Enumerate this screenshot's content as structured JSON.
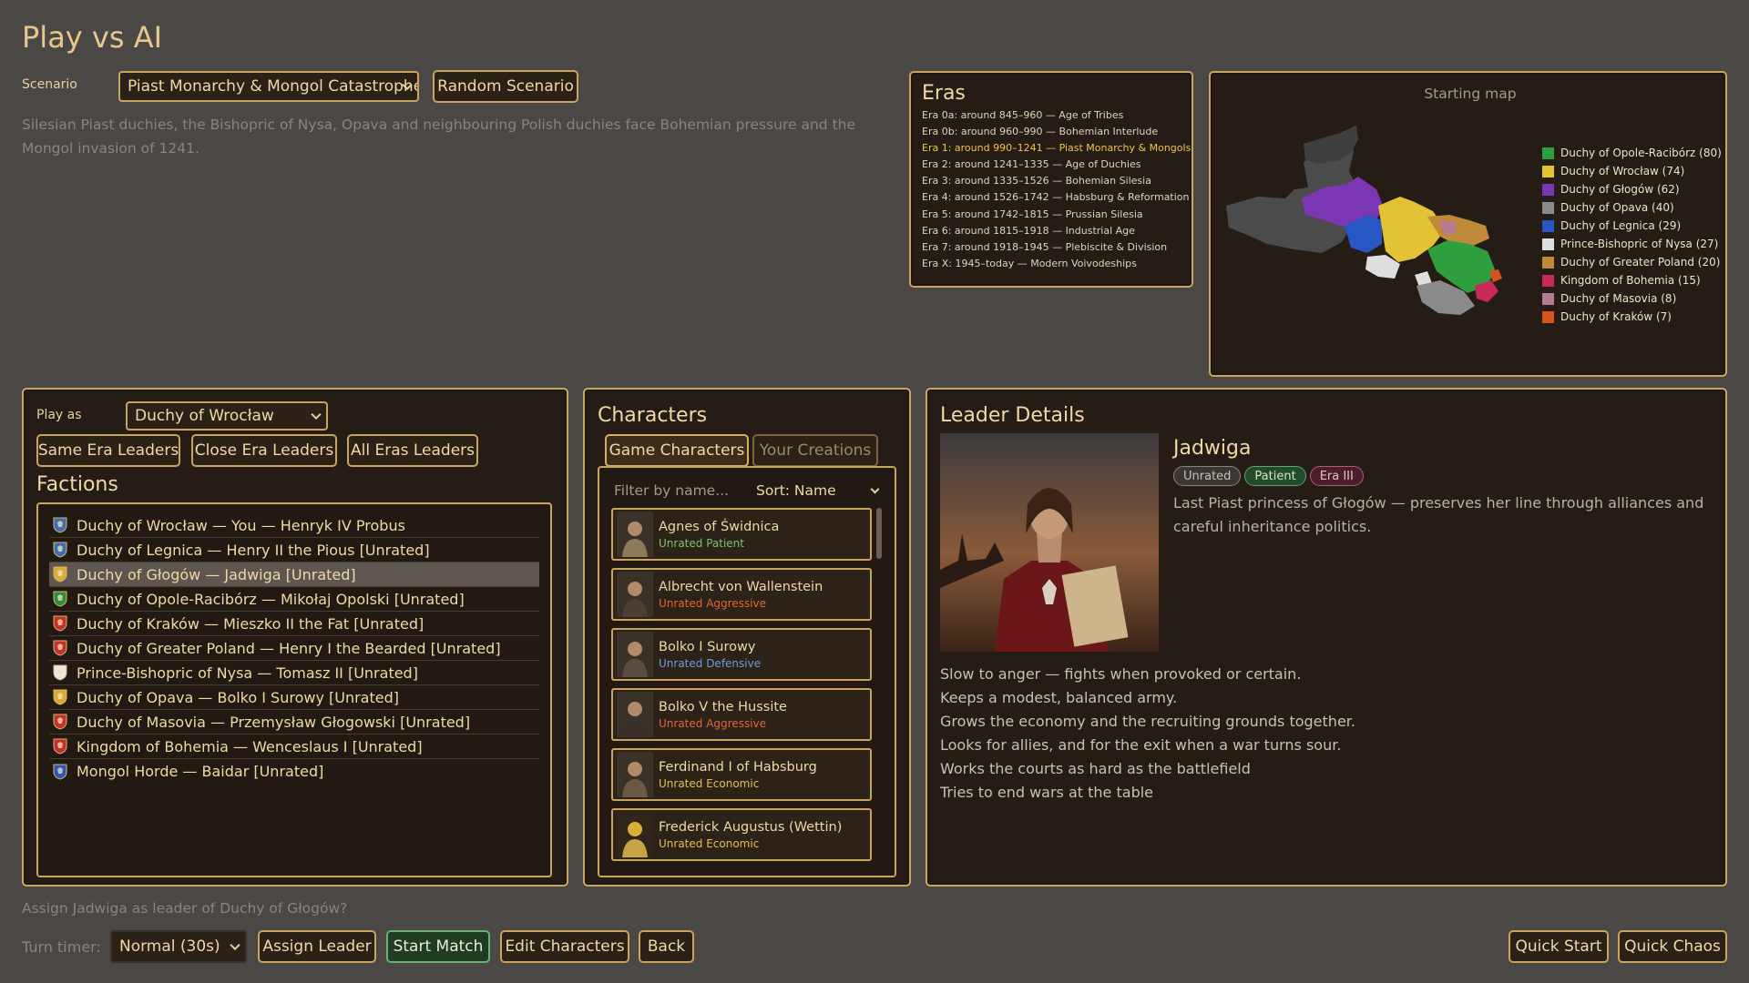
{
  "page": {
    "title": "Play vs AI"
  },
  "scenario": {
    "label": "Scenario",
    "selected": "Piast Monarchy & Mongol Catastrophe",
    "random_label": "Random Scenario",
    "description_line1": "Silesian Piast duchies, the Bishopric of Nysa, Opava and neighbouring Polish duchies face Bohemian pressure and the",
    "description_line2": "Mongol invasion of 1241."
  },
  "eras": {
    "title": "Eras",
    "items": [
      "Era 0a: around 845–960 — Age of Tribes",
      "Era 0b: around 960–990 — Bohemian Interlude",
      "Era 1: around 990–1241 — Piast Monarchy & Mongols",
      "Era 2: around 1241–1335 — Age of Duchies",
      "Era 3: around 1335–1526 — Bohemian Silesia",
      "Era 4: around 1526–1742 — Habsburg & Reformation",
      "Era 5: around 1742–1815 — Prussian Silesia",
      "Era 6: around 1815–1918 — Industrial Age",
      "Era 7: around 1918–1945 — Plebiscite & Division",
      "Era X: 1945–today — Modern Voivodeships"
    ],
    "active_index": 2
  },
  "map": {
    "title": "Starting map",
    "legend": [
      {
        "label": "Duchy of Opole-Racibórz (80)",
        "color": "#2e9e3e"
      },
      {
        "label": "Duchy of Wrocław (74)",
        "color": "#e3c234"
      },
      {
        "label": "Duchy of Głogów (62)",
        "color": "#7b36b3"
      },
      {
        "label": "Duchy of Opava (40)",
        "color": "#8a8a8a"
      },
      {
        "label": "Duchy of Legnica (29)",
        "color": "#2856c4"
      },
      {
        "label": "Prince-Bishopric of Nysa (27)",
        "color": "#dedede"
      },
      {
        "label": "Duchy of Greater Poland (20)",
        "color": "#c08a3a"
      },
      {
        "label": "Kingdom of Bohemia (15)",
        "color": "#c9285a"
      },
      {
        "label": "Duchy of Masovia (8)",
        "color": "#b57b92"
      },
      {
        "label": "Duchy of Kraków (7)",
        "color": "#d8541c"
      }
    ]
  },
  "factions_panel": {
    "play_as_label": "Play as",
    "play_as_value": "Duchy of Wrocław",
    "same_era_label": "Same Era Leaders",
    "close_era_label": "Close Era Leaders",
    "all_eras_label": "All Eras Leaders",
    "title": "Factions",
    "items": [
      {
        "text": "Duchy of Wrocław — You — Henryk IV Probus",
        "shield": "#3d6fb0"
      },
      {
        "text": "Duchy of Legnica — Henry II the Pious [Unrated]",
        "shield": "#3d6fb0"
      },
      {
        "text": "Duchy of Głogów — Jadwiga [Unrated]",
        "shield": "#d9a93a"
      },
      {
        "text": "Duchy of Opole-Racibórz — Mikołaj Opolski [Unrated]",
        "shield": "#2e8e3e"
      },
      {
        "text": "Duchy of Kraków — Mieszko II the Fat [Unrated]",
        "shield": "#c23030"
      },
      {
        "text": "Duchy of Greater Poland — Henry I the Bearded [Unrated]",
        "shield": "#c23030"
      },
      {
        "text": "Prince-Bishopric of Nysa — Tomasz II [Unrated]",
        "shield": "#e8e8e8"
      },
      {
        "text": "Duchy of Opava — Bolko I Surowy [Unrated]",
        "shield": "#d9a93a"
      },
      {
        "text": "Duchy of Masovia — Przemysław Głogowski [Unrated]",
        "shield": "#c23030"
      },
      {
        "text": "Kingdom of Bohemia — Wenceslaus I [Unrated]",
        "shield": "#c23030"
      },
      {
        "text": "Mongol Horde — Baidar [Unrated]",
        "shield": "#2e56b8"
      }
    ],
    "selected_index": 2
  },
  "characters_panel": {
    "title": "Characters",
    "tab_game": "Game Characters",
    "tab_yours": "Your Creations",
    "filter_placeholder": "Filter by name...",
    "sort_label": "Sort: Name",
    "items": [
      {
        "name": "Agnes of Świdnica",
        "rating": "Unrated Patient",
        "color": "#7cc46a"
      },
      {
        "name": "Albrecht von Wallenstein",
        "rating": "Unrated Aggressive",
        "color": "#e0673a"
      },
      {
        "name": "Bolko I Surowy",
        "rating": "Unrated Defensive",
        "color": "#6f9be0"
      },
      {
        "name": "Bolko V the Hussite",
        "rating": "Unrated Aggressive",
        "color": "#e0673a"
      },
      {
        "name": "Ferdinand I of Habsburg",
        "rating": "Unrated Economic",
        "color": "#e0c050"
      },
      {
        "name": "Frederick Augustus (Wettin)",
        "rating": "Unrated Economic",
        "color": "#e0c050"
      }
    ]
  },
  "leader_details": {
    "title": "Leader Details",
    "name": "Jadwiga",
    "badges": [
      "Unrated",
      "Patient",
      "Era III"
    ],
    "bio_line1": "Last Piast princess of Głogów — preserves her line through alliances and",
    "bio_line2": "careful inheritance politics.",
    "traits": [
      "Slow to anger — fights when provoked or certain.",
      "Keeps a modest, balanced army.",
      "Grows the economy and the recruiting grounds together.",
      "Looks for allies, and for the exit when a war turns sour.",
      "Works the courts as hard as the battlefield",
      "Tries to end wars at the table"
    ]
  },
  "footer": {
    "confirm_text": "Assign Jadwiga as leader of Duchy of Głogów?",
    "turn_timer_label": "Turn timer:",
    "turn_timer_value": "Normal (30s)",
    "assign_label": "Assign Leader",
    "start_label": "Start Match",
    "edit_label": "Edit Characters",
    "back_label": "Back",
    "quick_start_label": "Quick Start",
    "quick_chaos_label": "Quick Chaos"
  }
}
